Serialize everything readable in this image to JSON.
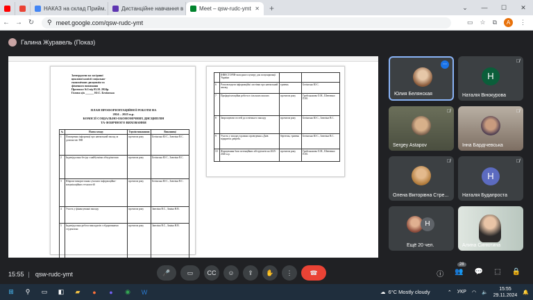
{
  "browser": {
    "tabs": [
      {
        "label": "",
        "active": false
      },
      {
        "label": "",
        "active": false
      },
      {
        "label": "НАКАЗ на склад Прийм. комі",
        "active": false
      },
      {
        "label": "Дистанційне навчання в ВСП",
        "active": false
      },
      {
        "label": "Meet – qsw-rudc-ymt",
        "active": true
      }
    ],
    "url": "meet.google.com/qsw-rudc-ymt",
    "profile_initial": "A"
  },
  "meet": {
    "presenter": "Галина Журавель (Показ)",
    "participants": [
      {
        "name": "Юлия Белянская",
        "initial": "",
        "speaking": true
      },
      {
        "name": "Наталія Вінокурова",
        "initial": "Н",
        "speaking": false
      },
      {
        "name": "Sergey Astapov",
        "initial": "",
        "speaking": false
      },
      {
        "name": "Інна Бардічевська",
        "initial": "",
        "speaking": false
      },
      {
        "name": "Олена Вікторівна Стре...",
        "initial": "",
        "speaking": false
      },
      {
        "name": "Наталія Будапроста",
        "initial": "Н",
        "speaking": false
      },
      {
        "name": "Ещё 20 чел.",
        "initial": "Н",
        "speaking": false
      },
      {
        "name": "Алина Синютина",
        "initial": "",
        "speaking": false
      }
    ],
    "time": "15:55",
    "meeting_code": "qsw-rudc-ymt",
    "participant_count": "28"
  },
  "document": {
    "header_lines": [
      "Затверджено на засіданні",
      "циклової комісії соціально-",
      "економічних дисциплін та",
      "фізичного виховання",
      "Протокол №3 від 03.10. 2024р.",
      "Голова ц/к ______ Ю.С. Белінська"
    ],
    "title_lines": [
      "ПЛАН ПРОФОРІЄНТАЦІЙНОЇ РОБОТИ НА",
      "2024 – 2025 н.р.",
      "КОМІСІЇ СОЦІАЛЬНО-ЕКОНОМІЧНИХ ДИСЦИПЛІН",
      "ТА ФІЗИЧНОГО ВИХОВАННЯ"
    ],
    "columns": [
      "№",
      "Назва заходу",
      "Термін виконання",
      "Виконавці"
    ],
    "rows1": [
      [
        "1",
        "Поширення інформації про навчальний заклад за допомогою ЗМІ",
        "протягом року",
        "Белінська Ю.С., Завєзіна В.С."
      ],
      [
        "2",
        "Індивідуальна бесіда з майбутніми абітурієнтами",
        "протягом року",
        "Белінська Ю.С., Завєзіна В.С."
      ],
      [
        "3",
        "Широке використання сучасних інформаційно-комунікаційних технологій",
        "протягом року",
        "Белінська Ю.С., Завєзіна В.С."
      ],
      [
        "4",
        "Участь у фінансуванні закладу",
        "протягом року",
        "Завєзіна В.С., Зоніна Н.В."
      ],
      [
        "5",
        "Індивідуальна робота викладачів з обдарованими студентами",
        "протягом року",
        "Завєзіна В.С., Зоніна Н.В."
      ]
    ],
    "rows2": [
      [
        "",
        "ІНВЕСТОРІВ-молодшого центру для популяризації України",
        "",
        ""
      ],
      [
        "6",
        "Розповсюдити інформаційні листівки про навчальний заклад",
        "травень",
        "Белінська Ю.С."
      ],
      [
        "7",
        "Профорієнтаційна робота в сільських школах",
        "протягом року",
        "Грибськанова О.М., Шевченко П.М."
      ],
      [
        "8",
        "Запрошувати гостей до освітнього закладу",
        "протягом року",
        "Белінська Ю.С., Завєзіна В.С."
      ],
      [
        "9",
        "Участь у заходах в рамках проведення «Днів відкритих дверей»",
        "березень, травень",
        "Белінська Ю.С., Завєзіна В.С."
      ],
      [
        "10",
        "Формування бази потенційних абітурієнтів на 2025-2026 н.р.",
        "протягом року",
        "Грибськанова О.М., Шевченко П.М."
      ]
    ]
  },
  "taskbar": {
    "weather": "6°C  Mostly cloudy",
    "lang": "УКР",
    "clock_time": "15:55",
    "clock_date": "29.11.2024"
  },
  "colors": {
    "accent": "#1a73e8",
    "end_call": "#ea4335",
    "meet_bg": "#202124",
    "tile_bg": "#3c4043"
  }
}
